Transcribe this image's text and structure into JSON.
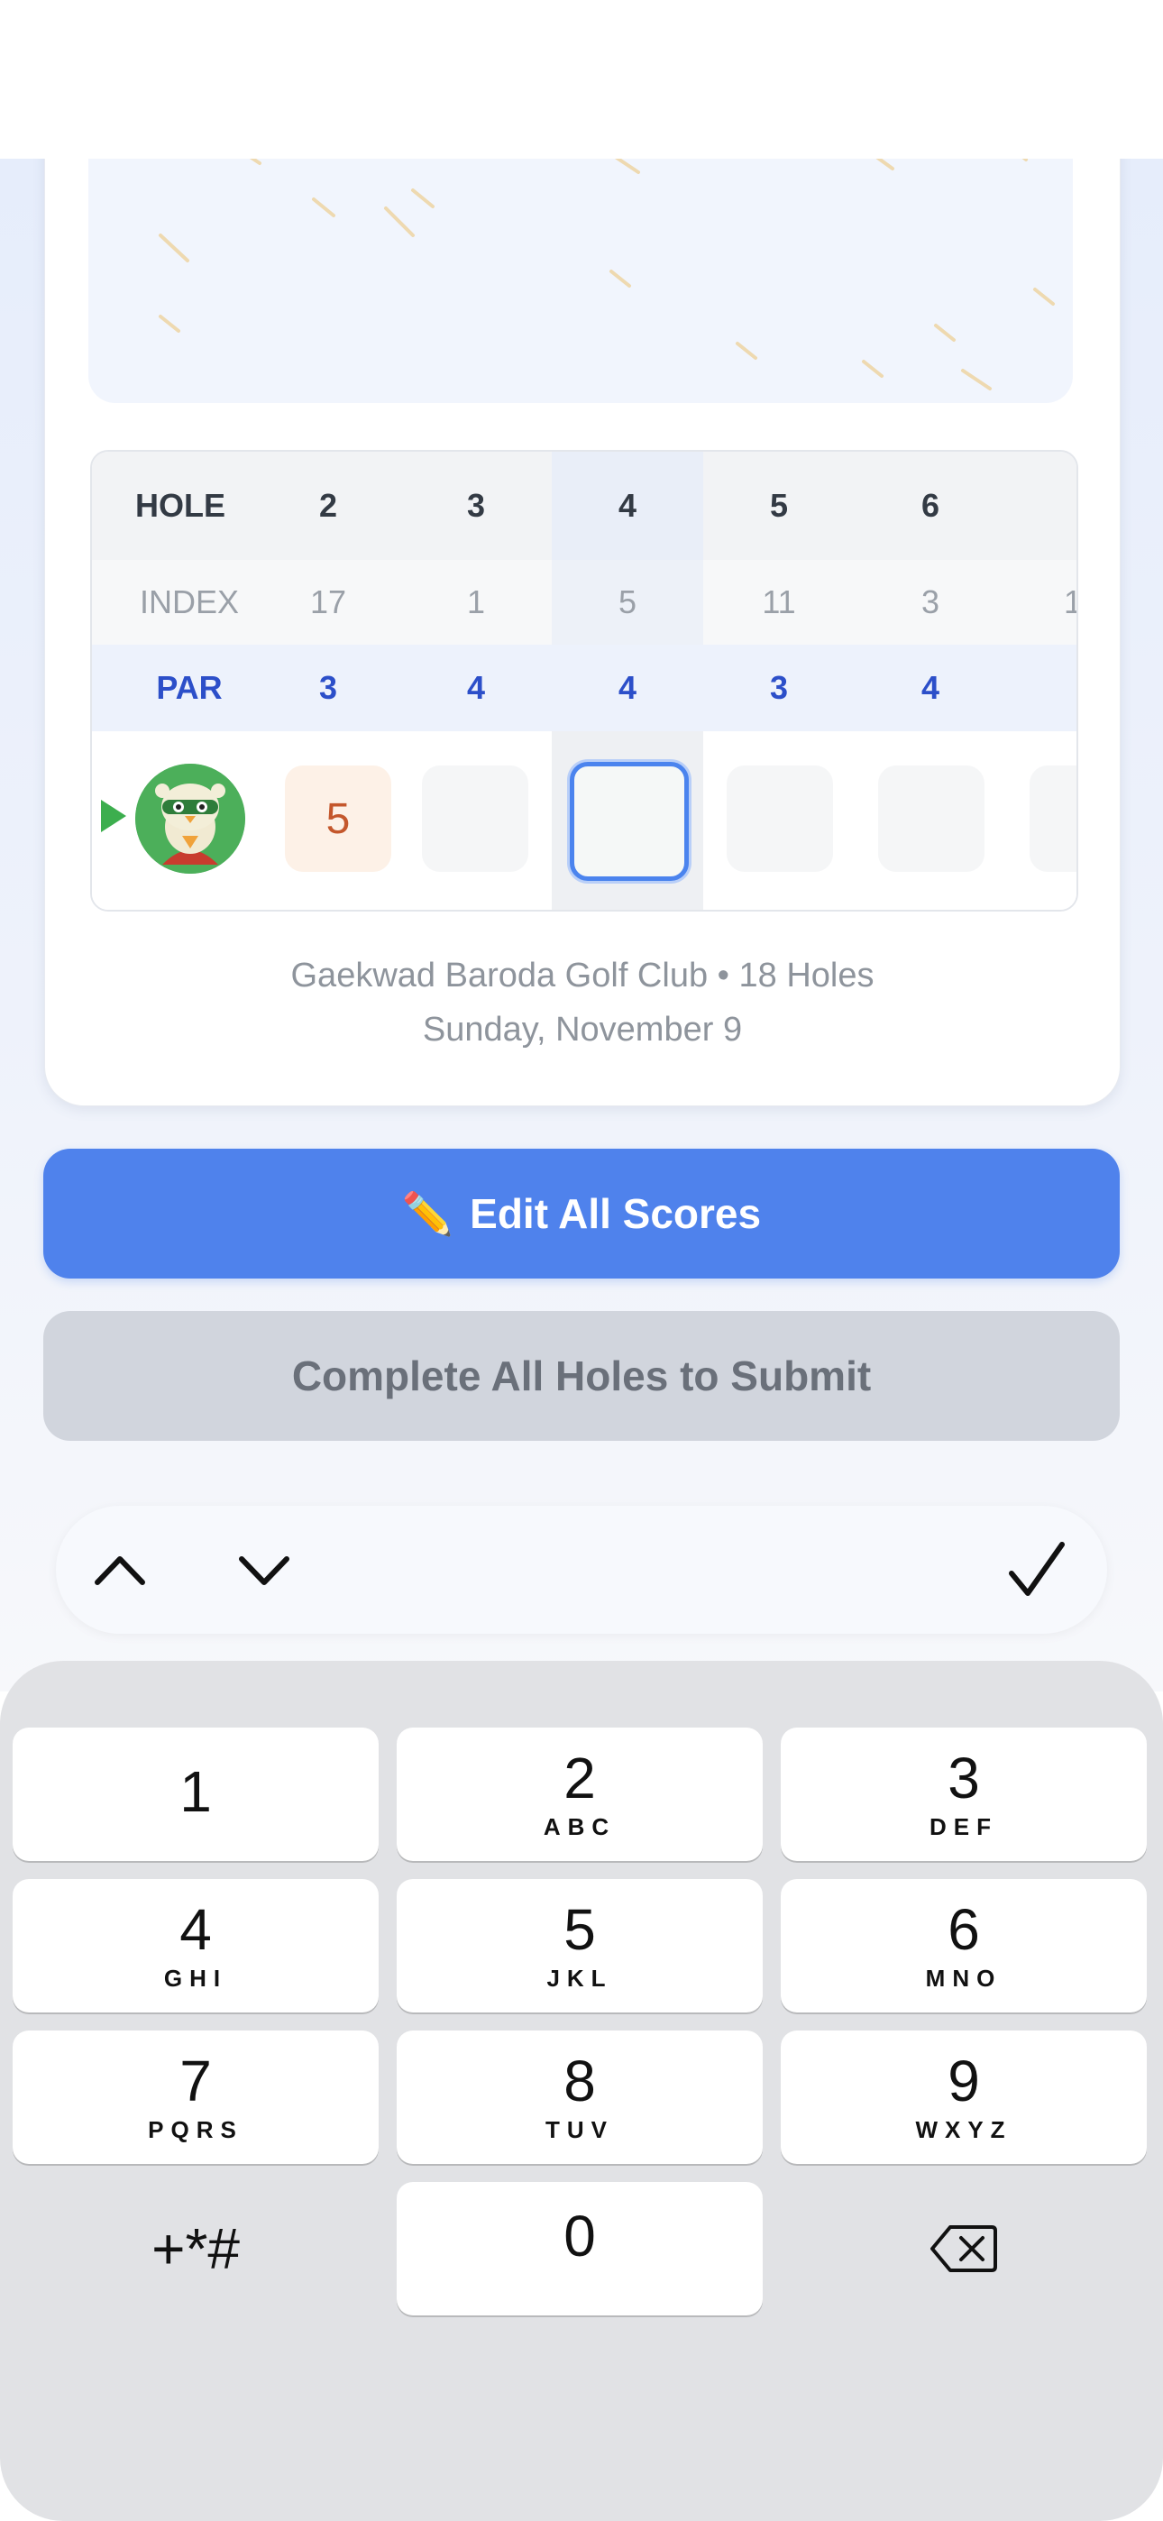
{
  "scorecard": {
    "hole_label": "HOLE",
    "index_label": "INDEX",
    "par_label": "PAR",
    "holes": [
      "2",
      "3",
      "4",
      "5",
      "6"
    ],
    "indexes": [
      "17",
      "1",
      "5",
      "11",
      "3",
      "1"
    ],
    "pars": [
      "3",
      "4",
      "4",
      "3",
      "4"
    ],
    "player_scores": [
      "5",
      "",
      "",
      "",
      "",
      ""
    ]
  },
  "course": {
    "name_line": "Gaekwad Baroda Golf Club • 18 Holes",
    "date_line": "Sunday, November 9"
  },
  "buttons": {
    "edit_icon": "✏️",
    "edit_label": "Edit All Scores",
    "submit_label": "Complete All Holes to Submit"
  },
  "accessory": {
    "icons": [
      "chevron-up-icon",
      "chevron-down-icon",
      "checkmark-icon"
    ]
  },
  "keypad": {
    "keys": [
      {
        "num": "1",
        "letters": ""
      },
      {
        "num": "2",
        "letters": "ABC"
      },
      {
        "num": "3",
        "letters": "DEF"
      },
      {
        "num": "4",
        "letters": "GHI"
      },
      {
        "num": "5",
        "letters": "JKL"
      },
      {
        "num": "6",
        "letters": "MNO"
      },
      {
        "num": "7",
        "letters": "PQRS"
      },
      {
        "num": "8",
        "letters": "TUV"
      },
      {
        "num": "9",
        "letters": "WXYZ"
      },
      {
        "num": "+*#",
        "letters": ""
      },
      {
        "num": "0",
        "letters": ""
      }
    ]
  },
  "colors": {
    "accent_blue": "#4f82ec",
    "par_blue": "#2c4fc9",
    "score_orange": "#c4572c",
    "active_border": "#4b84ee"
  }
}
